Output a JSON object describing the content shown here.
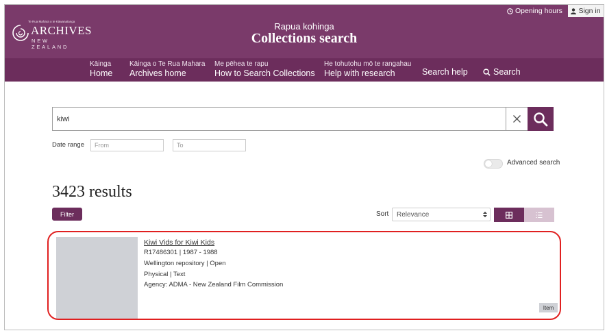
{
  "header": {
    "logo": {
      "tagline": "Te Rua Mahara o te Kāwanatanga",
      "wordmark": "ARCHIVES",
      "subtext": "NEW ZEALAND"
    },
    "subtitle": "Rapua kohinga",
    "title": "Collections search",
    "opening_hours": "Opening hours",
    "sign_in": "Sign in"
  },
  "nav": {
    "items": [
      {
        "small": "Kāinga",
        "big": "Home"
      },
      {
        "small": "Kāinga o Te Rua Mahara",
        "big": "Archives home"
      },
      {
        "small": "Me pēhea te rapu",
        "big": "How to Search Collections"
      },
      {
        "small": "He tohutohu mō te rangahau",
        "big": "Help with research"
      }
    ],
    "search_help": "Search help",
    "search": "Search"
  },
  "search": {
    "value": "kiwi",
    "date_range_label": "Date range",
    "from_placeholder": "From",
    "to_placeholder": "To",
    "advanced_search_label": "Advanced search",
    "advanced_search_on": false
  },
  "results": {
    "count_text": "3423 results",
    "filter_label": "Filter",
    "sort_label": "Sort",
    "sort_value": "Relevance",
    "view_mode": "grid",
    "items": [
      {
        "title": "Kiwi Vids for Kiwi Kids",
        "ref_dates": "R17486301 | 1987 - 1988",
        "repository": "Wellington repository | Open",
        "format": "Physical | Text",
        "agency": "Agency: ADMA - New Zealand Film Commission",
        "badge": "Item"
      }
    ]
  },
  "colors": {
    "header_purple": "#7a3a6a",
    "nav_purple": "#6c2d5c",
    "highlight_red": "#e02020"
  }
}
